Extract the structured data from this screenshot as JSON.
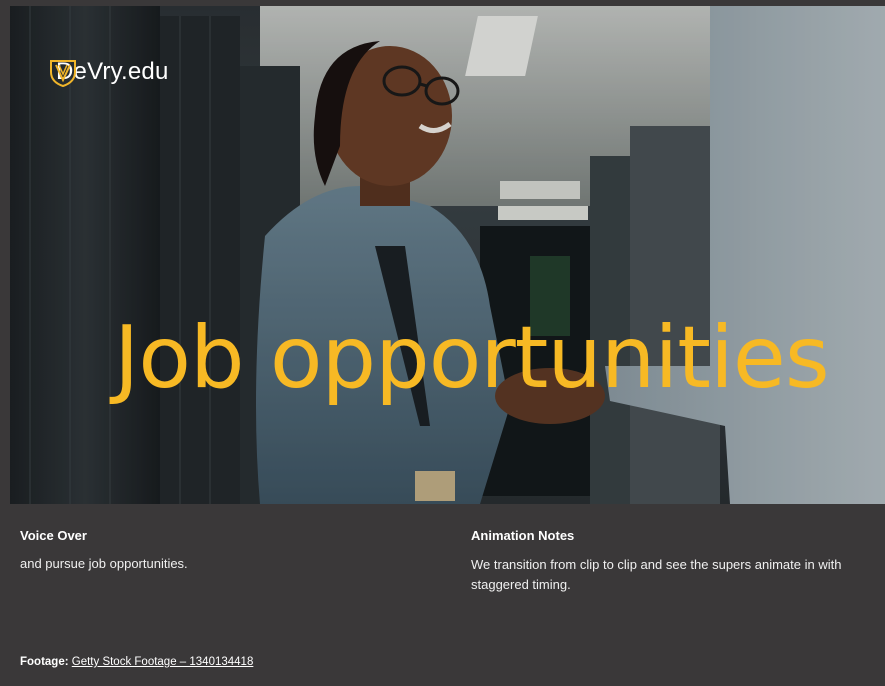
{
  "hero": {
    "logo_text": "DeVry.edu",
    "headline": "Job opportunities",
    "image": "woman-shaking-hands-in-server-room"
  },
  "notes": {
    "voice_over_heading": "Voice Over",
    "voice_over_text": "and pursue job opportunities.",
    "animation_heading": "Animation Notes",
    "animation_text": "We transition from clip to clip and see the supers animate in with staggered timing."
  },
  "footage": {
    "label": "Footage:",
    "link_text": "Getty Stock Footage – 1340134418"
  },
  "colors": {
    "headline": "#f7b924",
    "background": "#3a3839",
    "logo_mark": "#f0b52a"
  }
}
